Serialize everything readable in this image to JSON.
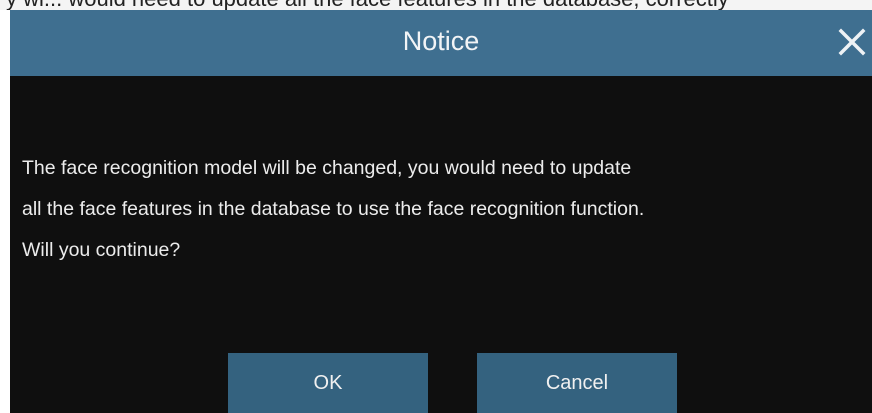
{
  "top_strip_text": "y wi... would need to update all the face features in the database, correctly",
  "dialog": {
    "title": "Notice",
    "close_icon": "close-icon",
    "message": "The face recognition model will be changed, you would need to update\nall the face features in the database to use the face recognition function.\nWill you continue?",
    "buttons": {
      "ok_label": "OK",
      "cancel_label": "Cancel"
    }
  },
  "colors": {
    "header": "#3f6f90",
    "body": "#0f0f0f",
    "button": "#34627f",
    "text": "#ececec"
  }
}
